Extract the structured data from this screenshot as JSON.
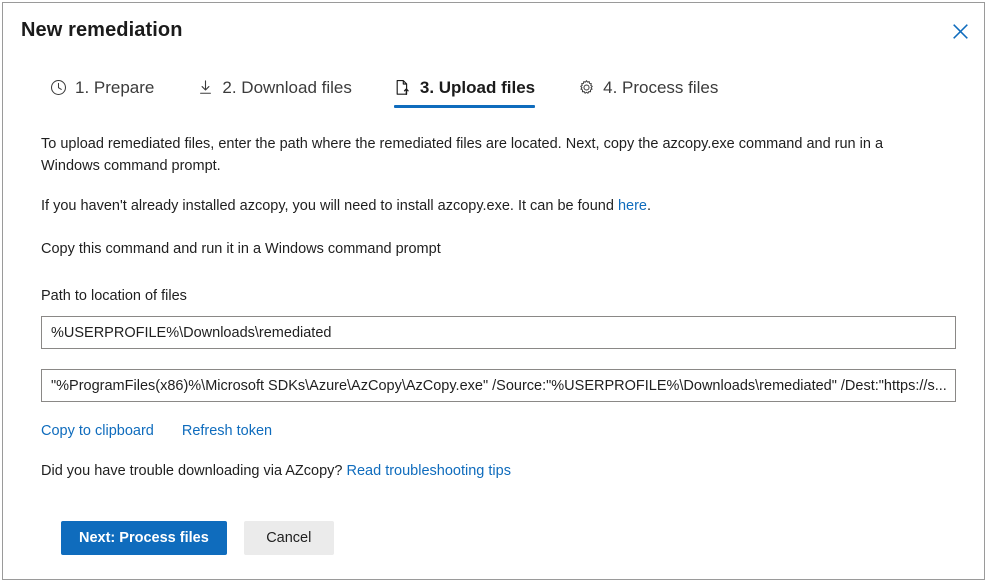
{
  "dialog": {
    "title": "New remediation",
    "close_label": "Close"
  },
  "tabs": [
    {
      "icon": "clock-icon",
      "label": "1. Prepare",
      "active": false
    },
    {
      "icon": "download-icon",
      "label": "2. Download files",
      "active": false
    },
    {
      "icon": "upload-file-icon",
      "label": "3. Upload files",
      "active": true
    },
    {
      "icon": "gear-icon",
      "label": "4. Process files",
      "active": false
    }
  ],
  "body": {
    "intro_paragraph": "To upload remediated files, enter the path where the remediated files are located. Next, copy the azcopy.exe command and run in a Windows command prompt.",
    "install_text_before": "If you haven't already installed azcopy, you will need to install azcopy.exe. It can be found ",
    "install_link": "here",
    "install_text_after": ".",
    "copy_instruction": "Copy this command and run it in a Windows command prompt",
    "path_label": "Path to location of files",
    "path_value": "%USERPROFILE%\\Downloads\\remediated",
    "command_value": "\"%ProgramFiles(x86)%\\Microsoft SDKs\\Azure\\AzCopy\\AzCopy.exe\" /Source:\"%USERPROFILE%\\Downloads\\remediated\" /Dest:\"https://s...",
    "copy_to_clipboard_link": "Copy to clipboard",
    "refresh_token_link": "Refresh token",
    "trouble_text": "Did you have trouble downloading via AZcopy? ",
    "trouble_link": "Read troubleshooting tips"
  },
  "footer": {
    "next_button": "Next: Process files",
    "cancel_button": "Cancel"
  },
  "colors": {
    "accent": "#0f6cbd",
    "text": "#1f1f1f",
    "border": "#8a8886",
    "secondary_button": "#ebebeb"
  }
}
